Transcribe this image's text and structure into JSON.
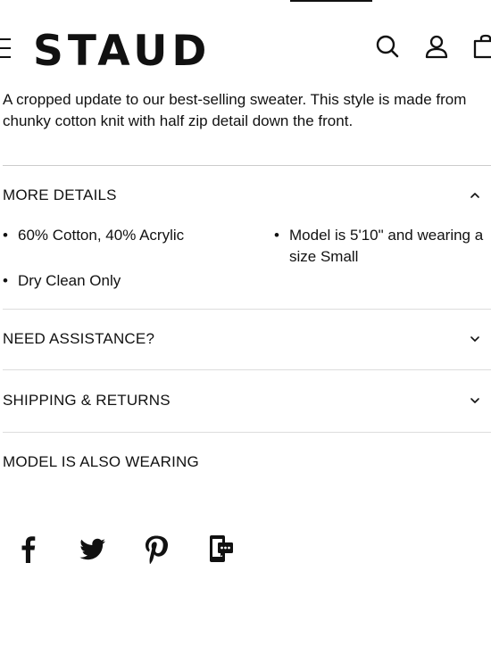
{
  "header": {
    "logo": "STAUD",
    "icons": [
      "menu-icon",
      "search-icon",
      "account-icon",
      "bag-icon"
    ]
  },
  "description": "A cropped update to our best-selling sweater. This style is made from chunky cotton knit with half zip detail down the front.",
  "more_details": {
    "title": "MORE DETAILS",
    "items": [
      "60% Cotton, 40% Acrylic",
      "Dry Clean Only",
      "Model is 5'10\" and wearing a size Small"
    ]
  },
  "accordions": {
    "assistance": "NEED ASSISTANCE?",
    "shipping": "SHIPPING & RETURNS",
    "model_wearing": "MODEL IS ALSO WEARING"
  },
  "social": [
    "facebook-icon",
    "twitter-icon",
    "pinterest-icon",
    "share-phone-icon"
  ]
}
